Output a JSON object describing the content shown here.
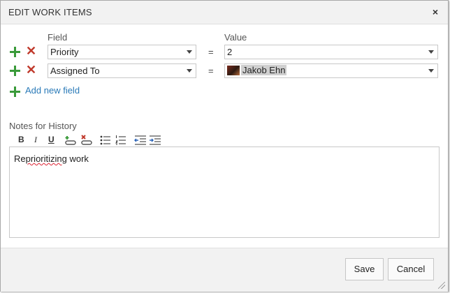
{
  "dialog": {
    "title": "EDIT WORK ITEMS",
    "close_glyph": "×"
  },
  "columns": {
    "field": "Field",
    "value": "Value"
  },
  "rows": [
    {
      "field": "Priority",
      "operator": "=",
      "value": "2",
      "value_has_avatar": false
    },
    {
      "field": "Assigned To",
      "operator": "=",
      "value": "Jakob Ehn",
      "value_has_avatar": true
    }
  ],
  "add_field_label": "Add new field",
  "notes": {
    "label": "Notes for History",
    "toolbar": {
      "bold": "B",
      "italic": "I",
      "underline": "U"
    },
    "text_prefix": "Re",
    "text_misspelled": "prioritizing",
    "text_rest": " work"
  },
  "buttons": {
    "save": "Save",
    "cancel": "Cancel"
  },
  "colors": {
    "add": "#3a9a3a",
    "remove": "#c0392b",
    "link": "#2a7ab8"
  },
  "icons": [
    "plus-icon",
    "remove-x-icon",
    "link-add-icon",
    "link-remove-icon",
    "bullet-list-icon",
    "numbered-list-icon",
    "outdent-icon",
    "indent-icon"
  ]
}
